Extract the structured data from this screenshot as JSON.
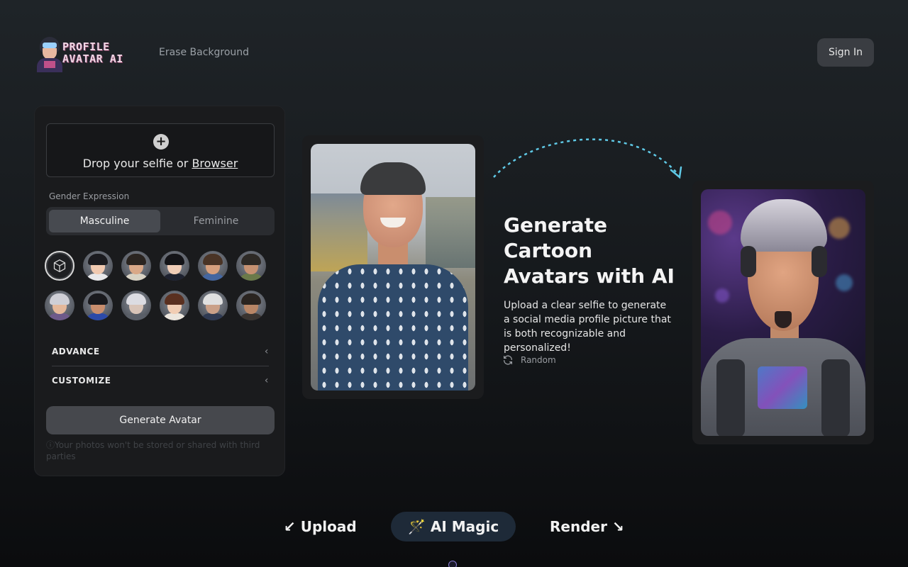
{
  "header": {
    "logo_line1": "PROFILE",
    "logo_line2": "AVATAR AI",
    "nav_erase": "Erase Background",
    "signin": "Sign In"
  },
  "upload": {
    "drop_text": "Drop your selfie or ",
    "browse_link": "Browser"
  },
  "gender": {
    "label": "Gender Expression",
    "options": [
      "Masculine",
      "Feminine"
    ],
    "selected": "Masculine"
  },
  "styles": {
    "row1": [
      {
        "skin": "#f0c9b0",
        "hair": "#1b1b1f",
        "body": "#e8e8ea"
      },
      {
        "skin": "#d9a888",
        "hair": "#2a2420",
        "body": "#d8d2c4"
      },
      {
        "skin": "#efcdb8",
        "hair": "#141418",
        "body": "#1e2230"
      },
      {
        "skin": "#d7a07e",
        "hair": "#4a3426",
        "body": "#4466a0"
      },
      {
        "skin": "#c79272",
        "hair": "#2e2a26",
        "body": "#6b7a4a"
      }
    ],
    "row2": [
      {
        "skin": "#e5b89a",
        "hair": "#cfcfd6",
        "body": "#6e5a8a"
      },
      {
        "skin": "#c98e6e",
        "hair": "#1a1a1e",
        "body": "#2c4aa8"
      },
      {
        "skin": "#d8c4b8",
        "hair": "#dcdce2",
        "body": "#5a5f68"
      },
      {
        "skin": "#f1cdb4",
        "hair": "#5a3020",
        "body": "#ece6de"
      },
      {
        "skin": "#caa088",
        "hair": "#e0e0e0",
        "body": "#2f3a52"
      },
      {
        "skin": "#b98666",
        "hair": "#2a2420",
        "body": "#3a3430"
      }
    ]
  },
  "accordion": {
    "advance": "ADVANCE",
    "customize": "CUSTOMIZE"
  },
  "generate_button": "Generate Avatar",
  "privacy_note": "Your photos won't be stored or shared with third parties",
  "hero": {
    "title": "Generate Cartoon Avatars with AI",
    "subtitle": "Upload a clear selfie to generate a social media profile picture that is both recognizable and personalized!",
    "random": "Random"
  },
  "steps": {
    "upload": "↙ Upload",
    "magic": "🪄 AI Magic",
    "render": "Render ↘"
  },
  "colors": {
    "accent_dashed": "#5fc9e6",
    "button_bg": "#46484d",
    "pill_bg": "#1e2a38"
  }
}
